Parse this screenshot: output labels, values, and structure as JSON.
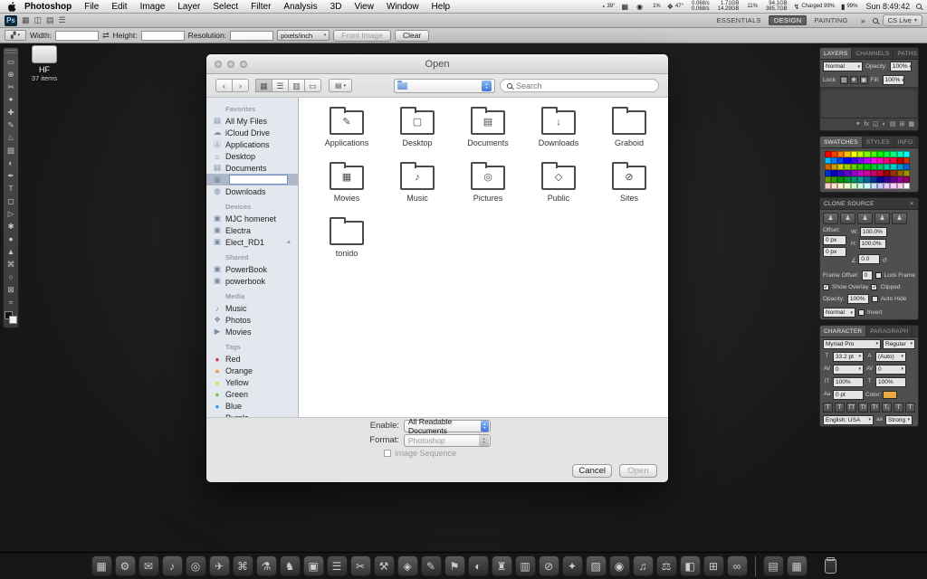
{
  "menu_bar": {
    "menus": [
      {
        "label": "Photoshop",
        "app": true
      },
      {
        "label": "File"
      },
      {
        "label": "Edit"
      },
      {
        "label": "Image"
      },
      {
        "label": "Layer"
      },
      {
        "label": "Select"
      },
      {
        "label": "Filter"
      },
      {
        "label": "Analysis"
      },
      {
        "label": "3D"
      },
      {
        "label": "View"
      },
      {
        "label": "Window"
      },
      {
        "label": "Help"
      }
    ],
    "status_items": [
      {
        "glyph": "◔",
        "top": "39°"
      },
      {
        "glyph": "▦"
      },
      {
        "glyph": "◉"
      },
      {
        "top": "1%"
      },
      {
        "glyph": "❖",
        "top": "47°"
      },
      {
        "top": "0.068/s",
        "bottom": "0.068/s"
      },
      {
        "top": "1.71GB",
        "bottom": "14.29GB"
      },
      {
        "top": "11%"
      },
      {
        "top": "94.1GB",
        "bottom": "385.7GB"
      },
      {
        "glyph": "↯",
        "top": "Charged 99%"
      },
      {
        "glyph": "▮",
        "top": "99%"
      },
      {
        "top": "Sun 8:49:42",
        "big": true
      }
    ]
  },
  "app_bar": {
    "logo": "Ps",
    "left_icons": [
      "▦",
      "◫",
      "▤",
      "☰"
    ],
    "workspaces": [
      {
        "label": "ESSENTIALS"
      },
      {
        "label": "DESIGN",
        "active": true
      },
      {
        "label": "PAINTING"
      }
    ],
    "overflow": "»",
    "cs_live": "CS Live"
  },
  "options_bar": {
    "width_label": "Width:",
    "width_value": "",
    "swap_icon": "⇄",
    "height_label": "Height:",
    "height_value": "",
    "resolution_label": "Resolution:",
    "resolution_value": "",
    "unit_value": "pixels/inch",
    "front_image_label": "Front Image",
    "clear_label": "Clear"
  },
  "tools": [
    "▭",
    "⊕",
    "✂",
    "✦",
    "✚",
    "✎",
    "♨",
    "▨",
    "◐",
    "✒",
    "T",
    "◻",
    "▷",
    "✱",
    "●",
    "▲",
    "⌘",
    "○",
    "⊠",
    "≈"
  ],
  "desktop_icon": {
    "title": "HF",
    "subtitle": "37 items"
  },
  "dialog": {
    "title": "Open",
    "toolbar": {
      "back": "‹",
      "forward": "›",
      "views": [
        {
          "glyph": "▦",
          "active": true
        },
        {
          "glyph": "☰"
        },
        {
          "glyph": "▥"
        },
        {
          "glyph": "▭"
        }
      ],
      "action_glyph": "▤",
      "search_placeholder": "Search"
    },
    "sidebar_rows": [
      {
        "label": "Favorites",
        "is_header": true
      },
      {
        "label": "All My Files",
        "icon": "▤"
      },
      {
        "label": "iCloud Drive",
        "icon": "☁"
      },
      {
        "label": "Applications",
        "icon": "Ⓐ"
      },
      {
        "label": "Desktop",
        "icon": "⌂"
      },
      {
        "label": "Documents",
        "icon": "▤"
      },
      {
        "label": "",
        "icon": "▦",
        "is_editing": true
      },
      {
        "label": "Downloads",
        "icon": "◍"
      },
      {
        "label": "Devices",
        "is_header": true
      },
      {
        "label": "MJC homenet",
        "icon": "▣"
      },
      {
        "label": "Electra",
        "icon": "▣"
      },
      {
        "label": "Elect_RD1",
        "icon": "▣",
        "eject": "▲"
      },
      {
        "label": "Shared",
        "is_header": true
      },
      {
        "label": "PowerBook",
        "icon": "▣"
      },
      {
        "label": "powerbook",
        "icon": "▣"
      },
      {
        "label": "Media",
        "is_header": true
      },
      {
        "label": "Music",
        "icon": "♪"
      },
      {
        "label": "Photos",
        "icon": "❖"
      },
      {
        "label": "Movies",
        "icon": "▶"
      },
      {
        "label": "Tags",
        "is_header": true
      },
      {
        "label": "Red",
        "icon": "●",
        "dot": "#e23b3b"
      },
      {
        "label": "Orange",
        "icon": "●",
        "dot": "#f09a36"
      },
      {
        "label": "Yellow",
        "icon": "●",
        "dot": "#f0d43d"
      },
      {
        "label": "Green",
        "icon": "●",
        "dot": "#67c950"
      },
      {
        "label": "Blue",
        "icon": "●",
        "dot": "#3f9bf4"
      },
      {
        "label": "Purple",
        "icon": "●",
        "dot": "#a55fc6"
      }
    ],
    "files": [
      {
        "name": "Applications",
        "emblem": "✎"
      },
      {
        "name": "Desktop",
        "emblem": "▢"
      },
      {
        "name": "Documents",
        "emblem": "▤"
      },
      {
        "name": "Downloads",
        "emblem": "↓"
      },
      {
        "name": "Graboid",
        "emblem": ""
      },
      {
        "name": "Movies",
        "emblem": "▦"
      },
      {
        "name": "Music",
        "emblem": "♪"
      },
      {
        "name": "Pictures",
        "emblem": "◎"
      },
      {
        "name": "Public",
        "emblem": "◇"
      },
      {
        "name": "Sites",
        "emblem": "⊘"
      },
      {
        "name": "tonido",
        "emblem": ""
      }
    ],
    "footer": {
      "enable_label": "Enable:",
      "enable_value": "All Readable Documents",
      "format_label": "Format:",
      "format_value": "Photoshop",
      "image_sequence_label": "Image Sequence"
    },
    "buttons": {
      "cancel": "Cancel",
      "open": "Open"
    }
  },
  "panels": {
    "layers": {
      "tabs": [
        {
          "label": "LAYERS",
          "active": true
        },
        {
          "label": "CHANNELS"
        },
        {
          "label": "PATHS"
        }
      ],
      "blend_value": "Normal",
      "opacity_label": "Opacity:",
      "opacity_value": "100%",
      "lock_label": "Lock:",
      "lock_icons": [
        "▨",
        "✚",
        "▣"
      ],
      "fill_label": "Fill:",
      "fill_value": "100%",
      "bottom_icons": [
        "⚭",
        "fx",
        "◱",
        "◐",
        "▤",
        "⊞",
        "▦"
      ]
    },
    "swatches": {
      "tabs": [
        {
          "label": "SWATCHES",
          "active": true
        },
        {
          "label": "STYLES"
        },
        {
          "label": "INFO"
        }
      ],
      "colors": [
        "#ff0000",
        "#ff4000",
        "#ff8000",
        "#ffbf00",
        "#ffff00",
        "#bfff00",
        "#80ff00",
        "#40ff00",
        "#00ff00",
        "#00ff40",
        "#00ff80",
        "#00ffbf",
        "#00ffff",
        "#00bfff",
        "#0080ff",
        "#0040ff",
        "#0000ff",
        "#4000ff",
        "#8000ff",
        "#bf00ff",
        "#ff00ff",
        "#ff00bf",
        "#ff0080",
        "#ff0040",
        "#cc0000",
        "#cc3300",
        "#cc6600",
        "#cc9900",
        "#cccc00",
        "#99cc00",
        "#66cc00",
        "#33cc00",
        "#00cc00",
        "#00cc33",
        "#00cc66",
        "#00cc99",
        "#00cccc",
        "#0099cc",
        "#0066cc",
        "#0033cc",
        "#0000cc",
        "#3300cc",
        "#6600cc",
        "#9900cc",
        "#cc00cc",
        "#cc0099",
        "#cc0066",
        "#cc0033",
        "#990000",
        "#993300",
        "#996600",
        "#999900",
        "#669900",
        "#339900",
        "#009900",
        "#009933",
        "#009966",
        "#009999",
        "#006699",
        "#003399",
        "#000099",
        "#330099",
        "#660099",
        "#990099",
        "#990066",
        "#ffcccc",
        "#ffe0cc",
        "#fff5cc",
        "#e8ffcc",
        "#ccffcc",
        "#ccffe8",
        "#ccffff",
        "#cce0ff",
        "#ccccff",
        "#e8ccff",
        "#ffccff",
        "#ffcce8",
        "#ffffff"
      ]
    },
    "clone": {
      "title": "CLONE SOURCE",
      "buttons": [
        "♟",
        "♟",
        "♟",
        "♟",
        "♟"
      ],
      "offset_label": "Offset:",
      "x_value": "0 px",
      "y_value": "0 px",
      "w_label": "W:",
      "w_value": "100.0%",
      "h_label": "H:",
      "h_value": "100.0%",
      "angle_value": "0.0",
      "frame_label": "Frame Offset:",
      "frame_value": "0",
      "lock_frame_label": "Lock Frame",
      "show_overlay_label": "Show Overlay",
      "clipped_label": "Clipped",
      "opacity_label": "Opacity:",
      "opacity_value": "100%",
      "auto_hide_label": "Auto Hide",
      "blend_value": "Normal",
      "invert_label": "Invert"
    },
    "character": {
      "tabs": [
        {
          "label": "CHARACTER",
          "active": true
        },
        {
          "label": "PARAGRAPH"
        }
      ],
      "font_family": "Myriad Pro",
      "font_style": "Regular",
      "icons": {
        "size": "T",
        "leading": "A",
        "kerning": "AV",
        "tracking": "AV",
        "vscale": "IT",
        "hscale": "T",
        "baseline": "Aa",
        "antialias": "aa"
      },
      "size_value": "33.2 pt",
      "leading_value": "(Auto)",
      "kerning_value": "0",
      "tracking_value": "0",
      "vscale_value": "100%",
      "hscale_value": "100%",
      "baseline_value": "0 pt",
      "color_label": "Color:",
      "color_value": "#e8aa3c",
      "style_buttons": [
        "T",
        "T",
        "TT",
        "Tt",
        "T¹",
        "T₁",
        "T",
        "T"
      ],
      "language_value": "English: USA",
      "antialias_value": "Strong"
    }
  },
  "dock": {
    "apps": [
      "▦",
      "⚙",
      "✉",
      "♪",
      "◎",
      "✈",
      "⌘",
      "⚗",
      "♞",
      "▣",
      "☰",
      "✂",
      "⚒",
      "◈",
      "✎",
      "⚑",
      "◐",
      "♜",
      "▥",
      "⊘",
      "✦",
      "▨",
      "◉",
      "♫",
      "⚖",
      "◧",
      "⊞",
      "∞"
    ],
    "stacks": [
      "▤",
      "▦"
    ]
  }
}
